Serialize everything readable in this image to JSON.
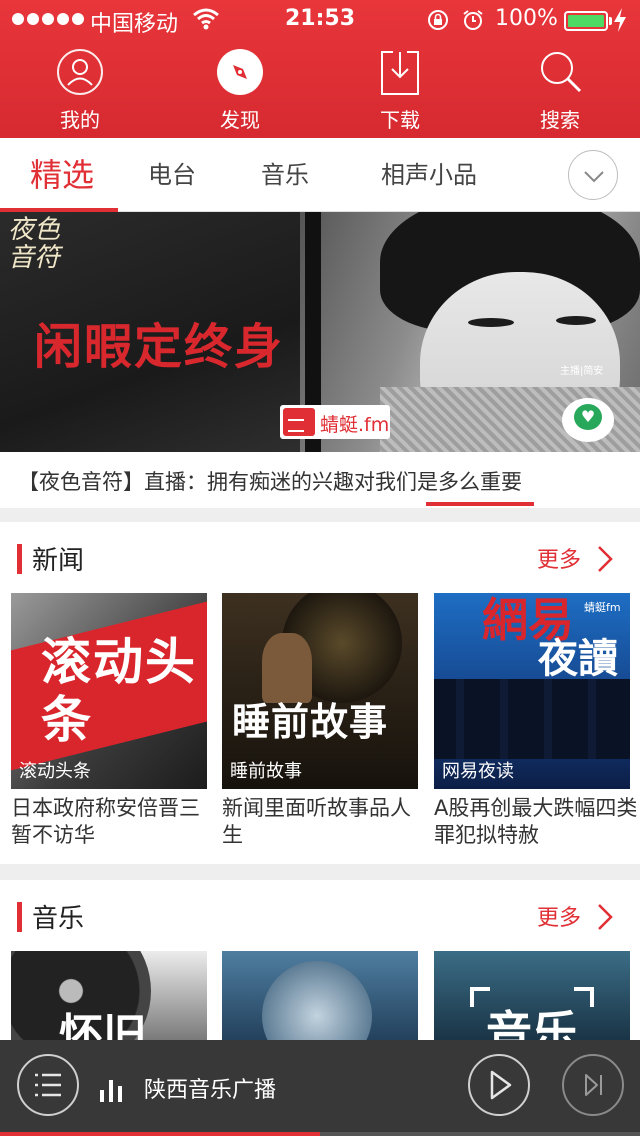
{
  "status_bar": {
    "carrier": "中国移动",
    "time": "21:53",
    "battery": "100%",
    "battery_level": 1.0
  },
  "top_nav": [
    {
      "label": "我的",
      "icon": "user-icon"
    },
    {
      "label": "发现",
      "icon": "compass-icon"
    },
    {
      "label": "下载",
      "icon": "download-icon"
    },
    {
      "label": "搜索",
      "icon": "search-icon"
    }
  ],
  "tabs": [
    {
      "label": "精选",
      "active": true
    },
    {
      "label": "电台",
      "active": false
    },
    {
      "label": "音乐",
      "active": false
    },
    {
      "label": "相声小品",
      "active": false
    }
  ],
  "banner": {
    "logo_text": "夜色音符",
    "title": "闲暇定终身",
    "anchor": "主播|简安",
    "badge": "蜻蜓.fm",
    "caption": "【夜色音符】直播：拥有痴迷的兴趣对我们是多么重要"
  },
  "news": {
    "title": "新闻",
    "more": "更多",
    "items": [
      {
        "image_text": "滚动头条",
        "tag": "滚动头条",
        "caption": "日本政府称安倍晋三暂不访华"
      },
      {
        "image_text": "睡前故事",
        "tag": "睡前故事",
        "caption": "新闻里面听故事品人生"
      },
      {
        "image_text_a": "網易",
        "image_text_b": "夜讀",
        "fm": "蜻蜓fm",
        "tag": "网易夜读",
        "caption": "A股再创最大跌幅四类罪犯拟特赦"
      }
    ]
  },
  "music": {
    "title": "音乐",
    "more": "更多",
    "items": [
      {
        "image_text": "怀旧"
      },
      {
        "image_text": ""
      },
      {
        "image_text": "音乐"
      }
    ]
  },
  "player": {
    "station": "陕西音乐广播",
    "progress": 0.5
  },
  "colors": {
    "accent": "#e02f35",
    "header": "#d62a30",
    "battery": "#4cd964"
  }
}
